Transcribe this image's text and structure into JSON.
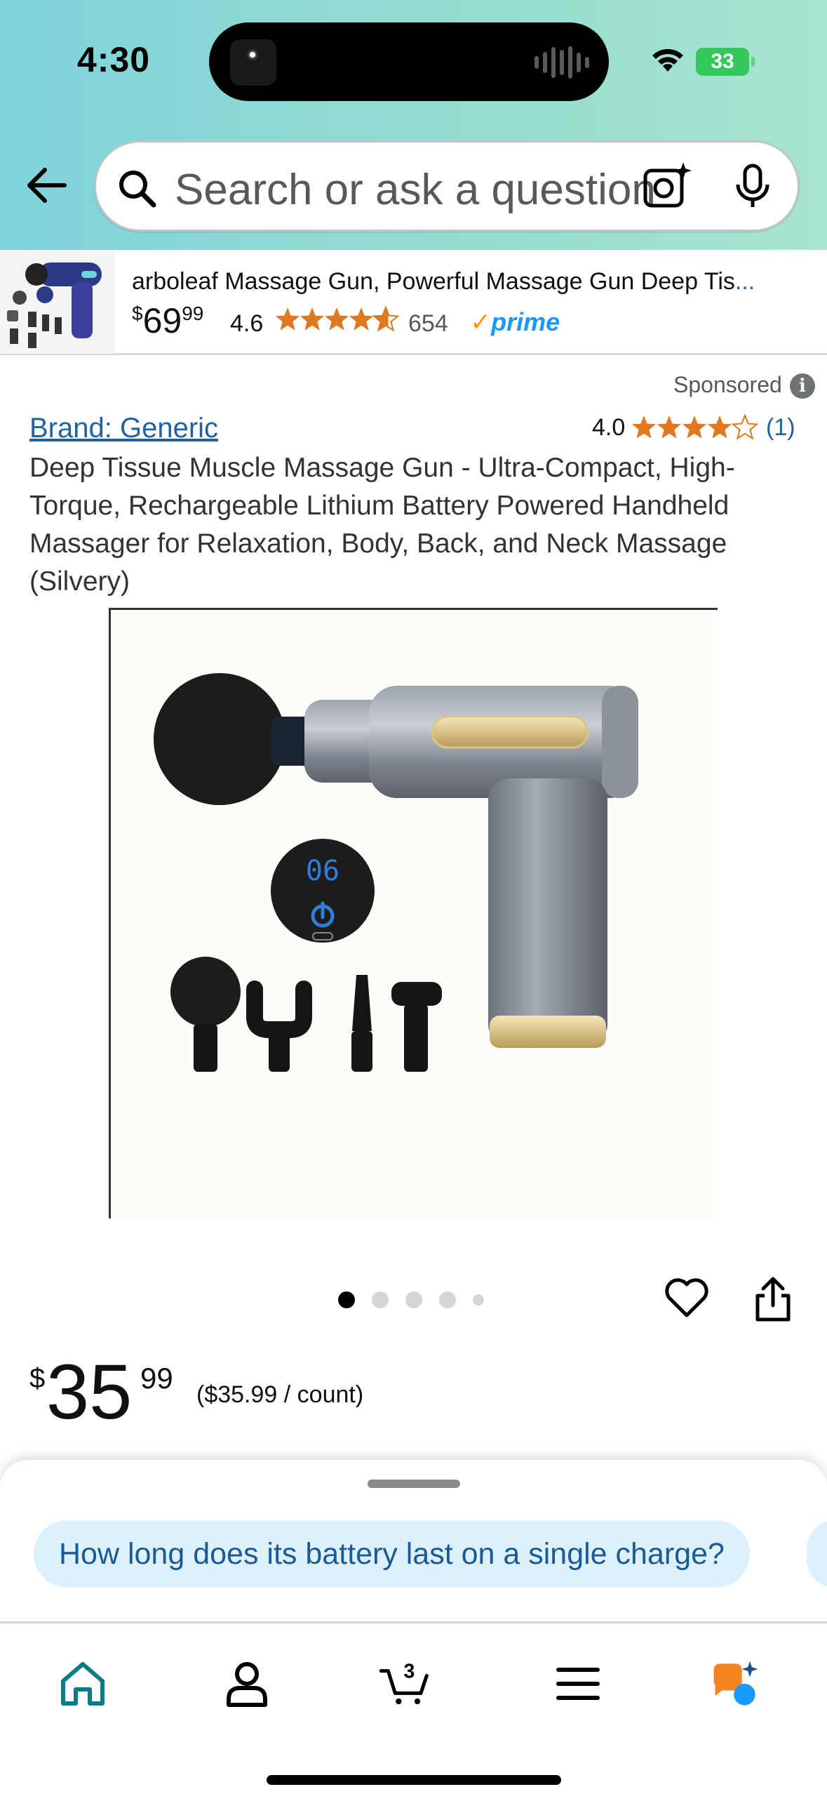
{
  "status_bar": {
    "time": "4:30",
    "battery": "33"
  },
  "search": {
    "placeholder": "Search or ask a question"
  },
  "sponsored_strip": {
    "title": "arboleaf Massage Gun, Powerful Massage Gun Deep Tis",
    "ellipsis": "...",
    "price_whole": "69",
    "price_fraction": "99",
    "currency": "$",
    "rating": "4.6",
    "review_count": "654",
    "prime": "prime"
  },
  "product": {
    "sponsored_label": "Sponsored",
    "brand": "Brand: Generic",
    "rating": "4.0",
    "review_count": "(1)",
    "title": "Deep Tissue Muscle Massage Gun - Ultra-Compact, High-Torque, Rechargeable Lithium Battery Powered Handheld Massager for Relaxation, Body, Back, and Neck Massage (Silvery)",
    "image_display": "06",
    "image_count": 5,
    "active_image": 1,
    "price_currency": "$",
    "price_whole": "35",
    "price_fraction": "99",
    "unit_price": "($35.99 / count)"
  },
  "rufus_sheet": {
    "question": "How long does its battery last on a single charge?"
  },
  "tabbar": {
    "cart_count": "3",
    "items": [
      "home-icon",
      "account-icon",
      "cart-icon",
      "menu-icon",
      "rufus-icon"
    ]
  },
  "colors": {
    "header_gradient_start": "#7fd3dc",
    "header_gradient_end": "#a8e5d0",
    "link_blue": "#2162a1",
    "star_orange": "#de7921",
    "prime_blue": "#1a98ff",
    "question_bg": "#dcf1fb",
    "home_teal": "#0a7c86"
  }
}
